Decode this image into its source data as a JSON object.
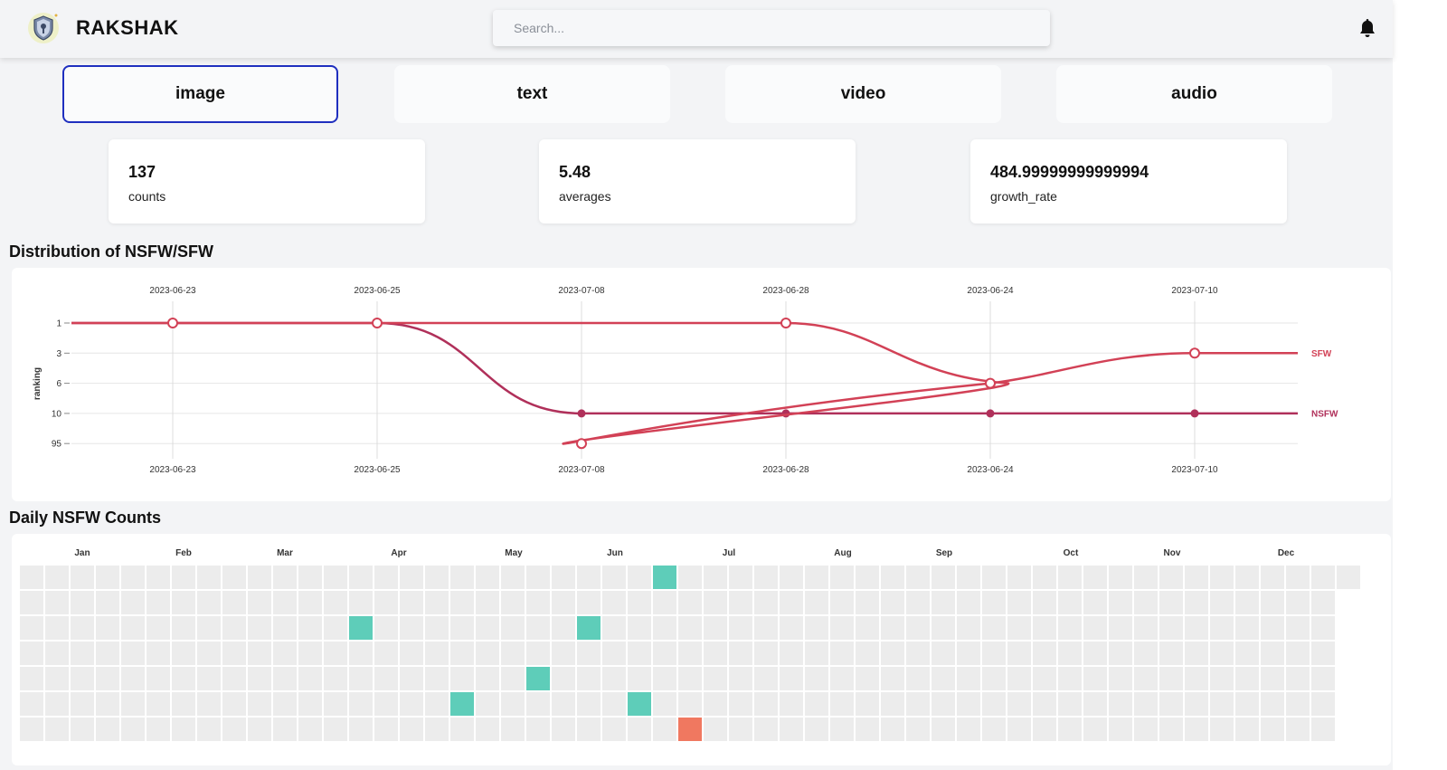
{
  "header": {
    "brand": "RAKSHAK",
    "search_placeholder": "Search...",
    "bell_icon": "bell-icon",
    "logo_icon": "shield-logo-icon"
  },
  "tabs": [
    {
      "label": "image",
      "active": true
    },
    {
      "label": "text",
      "active": false
    },
    {
      "label": "video",
      "active": false
    },
    {
      "label": "audio",
      "active": false
    }
  ],
  "stats": [
    {
      "value": "137",
      "label": "counts"
    },
    {
      "value": "5.48",
      "label": "averages"
    },
    {
      "value": "484.99999999999994",
      "label": "growth_rate"
    }
  ],
  "distribution": {
    "title": "Distribution of NSFW/SFW",
    "chart_data": {
      "type": "line",
      "ylabel": "ranking",
      "categories": [
        "2023-06-23",
        "2023-06-25",
        "2023-07-08",
        "2023-06-28",
        "2023-06-24",
        "2023-07-10"
      ],
      "y_ticks": [
        "1",
        "3",
        "6",
        "10",
        "95"
      ],
      "series": [
        {
          "name": "NSFW",
          "values": [
            "1",
            "1",
            "10",
            "10",
            "10",
            "10"
          ],
          "color": "#b0305a"
        },
        {
          "name": "SFW",
          "values": [
            "1",
            "1",
            "95",
            "1",
            "6",
            "3"
          ],
          "color": "#d24156"
        }
      ],
      "grid": true,
      "legend": "right, at line ends"
    }
  },
  "daily": {
    "title": "Daily NSFW Counts",
    "chart_data": {
      "type": "heatmap",
      "months": [
        "Jan",
        "Feb",
        "Mar",
        "Apr",
        "May",
        "Jun",
        "Jul",
        "Aug",
        "Sep",
        "Oct",
        "Nov",
        "Dec"
      ],
      "rows": 7,
      "empty_color": "#ececec",
      "cells": [
        {
          "week": 25,
          "day": 0,
          "color": "#5ecdb9"
        },
        {
          "week": 13,
          "day": 2,
          "color": "#5ecdb9"
        },
        {
          "week": 22,
          "day": 2,
          "color": "#5ecdb9"
        },
        {
          "week": 20,
          "day": 4,
          "color": "#5ecdb9"
        },
        {
          "week": 17,
          "day": 5,
          "color": "#5ecdb9"
        },
        {
          "week": 24,
          "day": 5,
          "color": "#5ecdb9"
        },
        {
          "week": 26,
          "day": 6,
          "color": "#f07860"
        }
      ]
    }
  }
}
